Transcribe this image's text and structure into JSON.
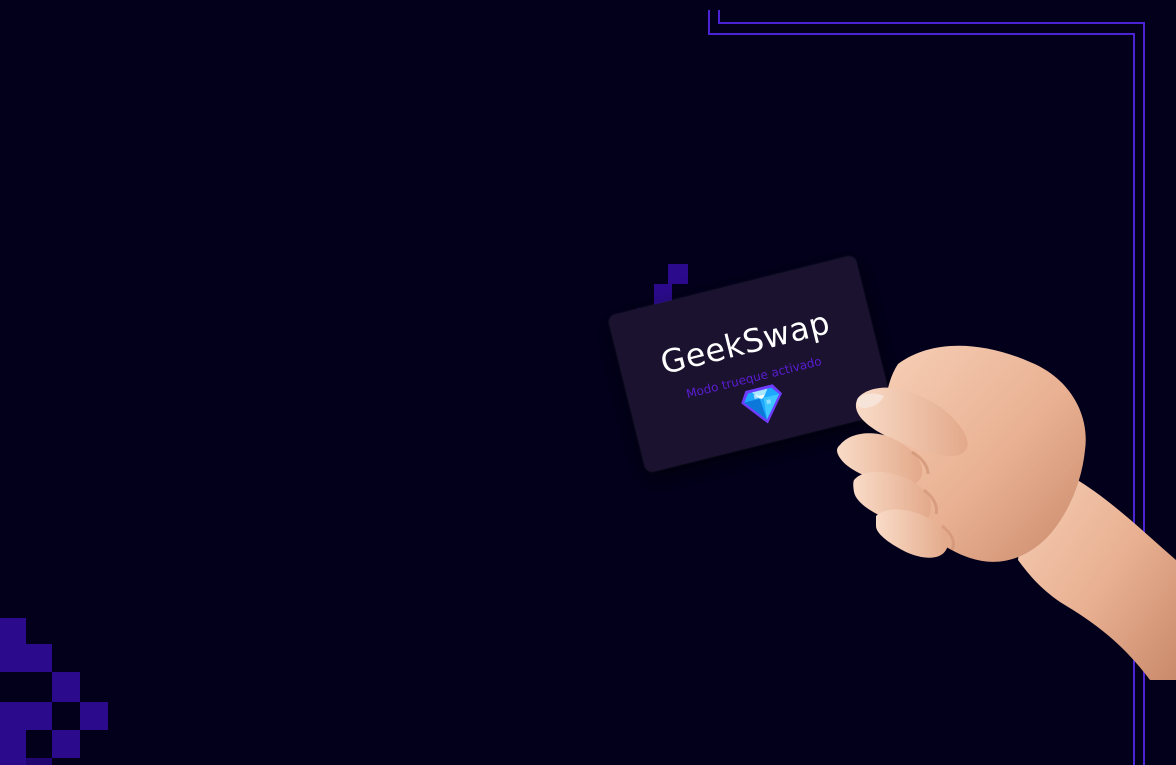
{
  "card": {
    "title": "GeekSwap",
    "subtitle": "Modo trueque activado",
    "icon": "diamond-icon"
  },
  "colors": {
    "background": "#03001b",
    "accent": "#4b22d6",
    "pixel": "#2b0b8c",
    "card": "#1b122f",
    "subtitle": "#5a1dd3"
  }
}
